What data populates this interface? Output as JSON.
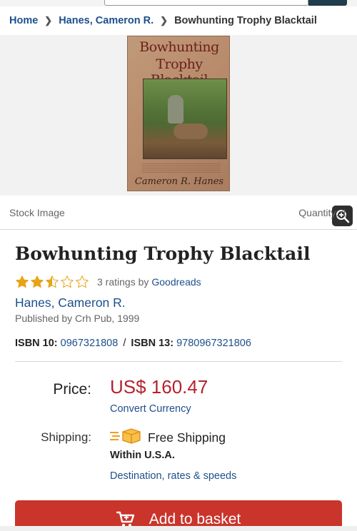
{
  "breadcrumb": {
    "home": "Home",
    "author": "Hanes, Cameron R.",
    "current": "Bowhunting Trophy Blacktail"
  },
  "cover": {
    "title_line1": "Bowhunting",
    "title_line2": "Trophy Blacktail",
    "author": "Cameron R. Hanes"
  },
  "image_meta": {
    "label": "Stock Image",
    "quantity": "Quantity: 1"
  },
  "book": {
    "title": "Bowhunting Trophy Blacktail",
    "rating_stars": 2.5,
    "ratings_text": "3 ratings by",
    "ratings_source": "Goodreads",
    "author": "Hanes, Cameron R.",
    "published": "Published by Crh Pub, 1999",
    "isbn10_label": "ISBN 10:",
    "isbn10": "0967321808",
    "isbn_sep": "/",
    "isbn13_label": "ISBN 13:",
    "isbn13": "9780967321806"
  },
  "pricing": {
    "price_label": "Price:",
    "price": "US$ 160.47",
    "convert": "Convert Currency",
    "shipping_label": "Shipping:",
    "shipping": "Free Shipping",
    "within": "Within U.S.A.",
    "destination": "Destination, rates & speeds"
  },
  "actions": {
    "add_to_basket": "Add to basket"
  },
  "colors": {
    "link": "#1d4f8c",
    "price": "#b5222e",
    "button": "#c9342b",
    "star": "#e8a317"
  },
  "icons": [
    "chevron-right-icon",
    "zoom-in-icon",
    "star-icon",
    "shipping-truck-icon",
    "cart-icon"
  ]
}
